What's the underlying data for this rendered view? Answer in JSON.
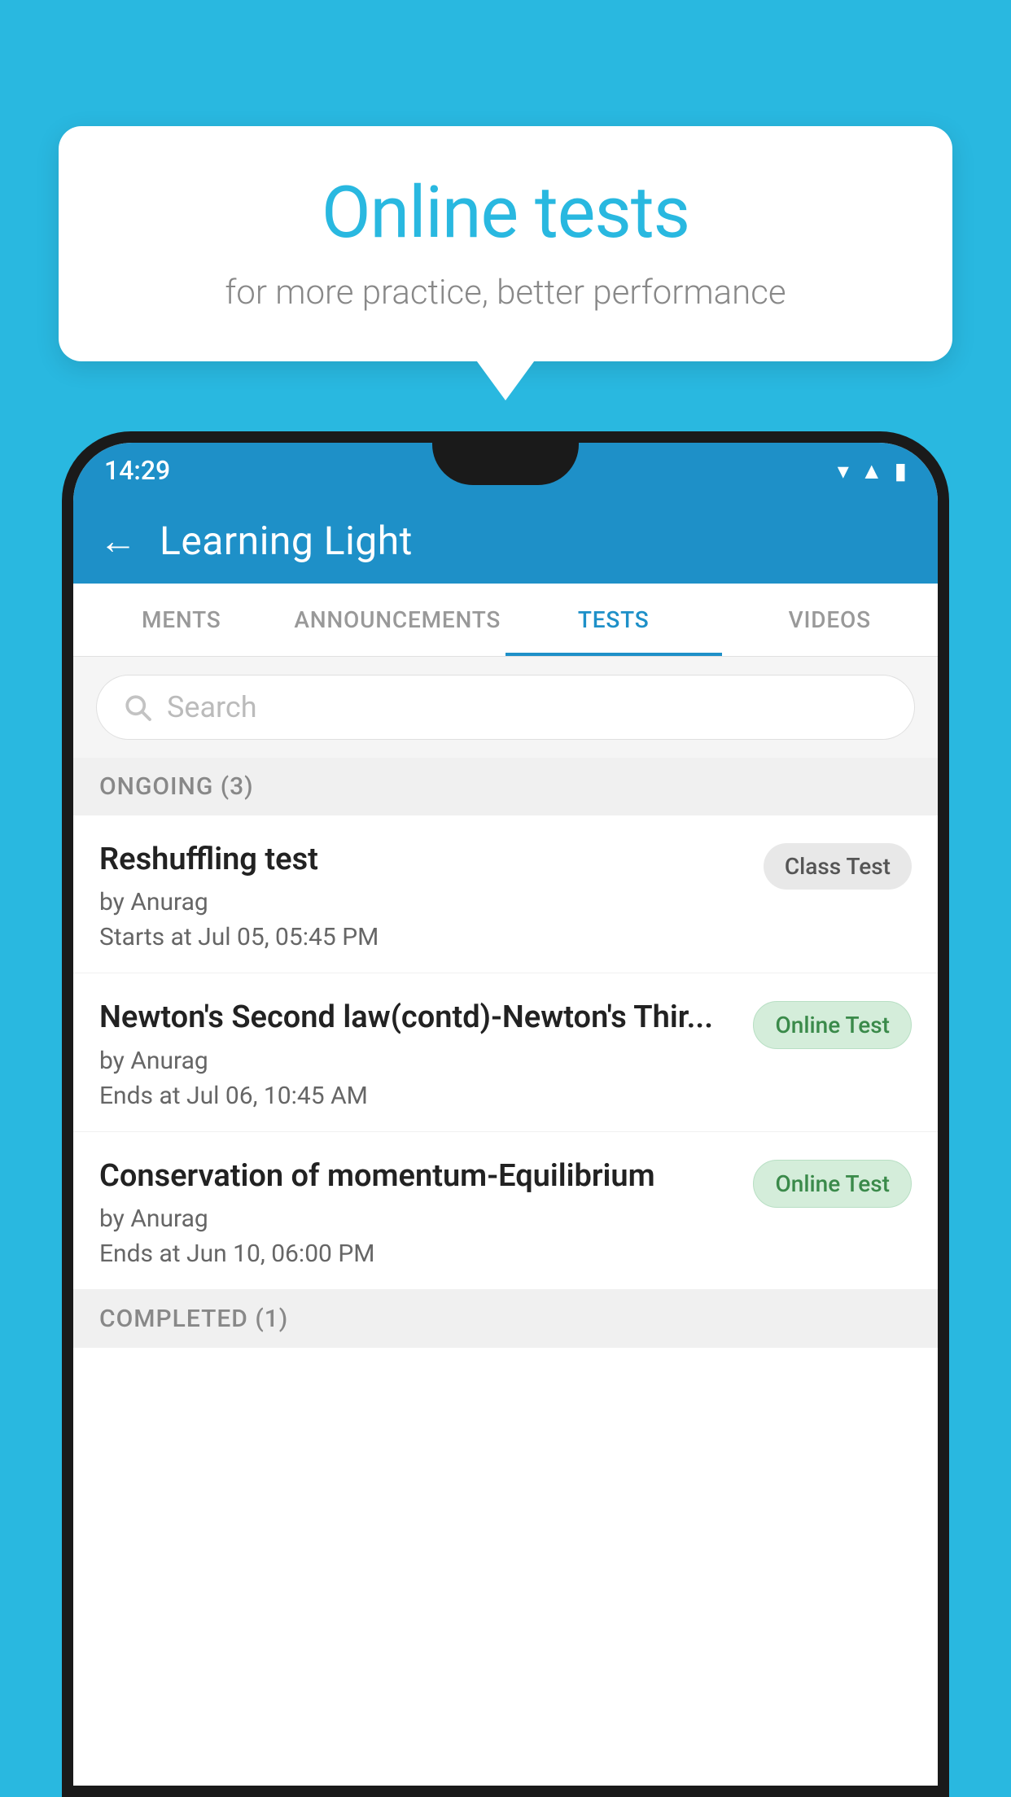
{
  "background_color": "#29b8e0",
  "speech_bubble": {
    "title": "Online tests",
    "subtitle": "for more practice, better performance"
  },
  "status_bar": {
    "time": "14:29",
    "icons": [
      "wifi",
      "signal",
      "battery"
    ]
  },
  "app_header": {
    "title": "Learning Light",
    "back_label": "←"
  },
  "tabs": [
    {
      "label": "MENTS",
      "active": false
    },
    {
      "label": "ANNOUNCEMENTS",
      "active": false
    },
    {
      "label": "TESTS",
      "active": true
    },
    {
      "label": "VIDEOS",
      "active": false
    }
  ],
  "search": {
    "placeholder": "Search"
  },
  "section_ongoing": {
    "label": "ONGOING (3)"
  },
  "tests": [
    {
      "name": "Reshuffling test",
      "author": "by Anurag",
      "date": "Starts at  Jul 05, 05:45 PM",
      "badge": "Class Test",
      "badge_type": "class"
    },
    {
      "name": "Newton's Second law(contd)-Newton's Thir...",
      "author": "by Anurag",
      "date": "Ends at  Jul 06, 10:45 AM",
      "badge": "Online Test",
      "badge_type": "online"
    },
    {
      "name": "Conservation of momentum-Equilibrium",
      "author": "by Anurag",
      "date": "Ends at  Jun 10, 06:00 PM",
      "badge": "Online Test",
      "badge_type": "online"
    }
  ],
  "section_completed": {
    "label": "COMPLETED (1)"
  }
}
